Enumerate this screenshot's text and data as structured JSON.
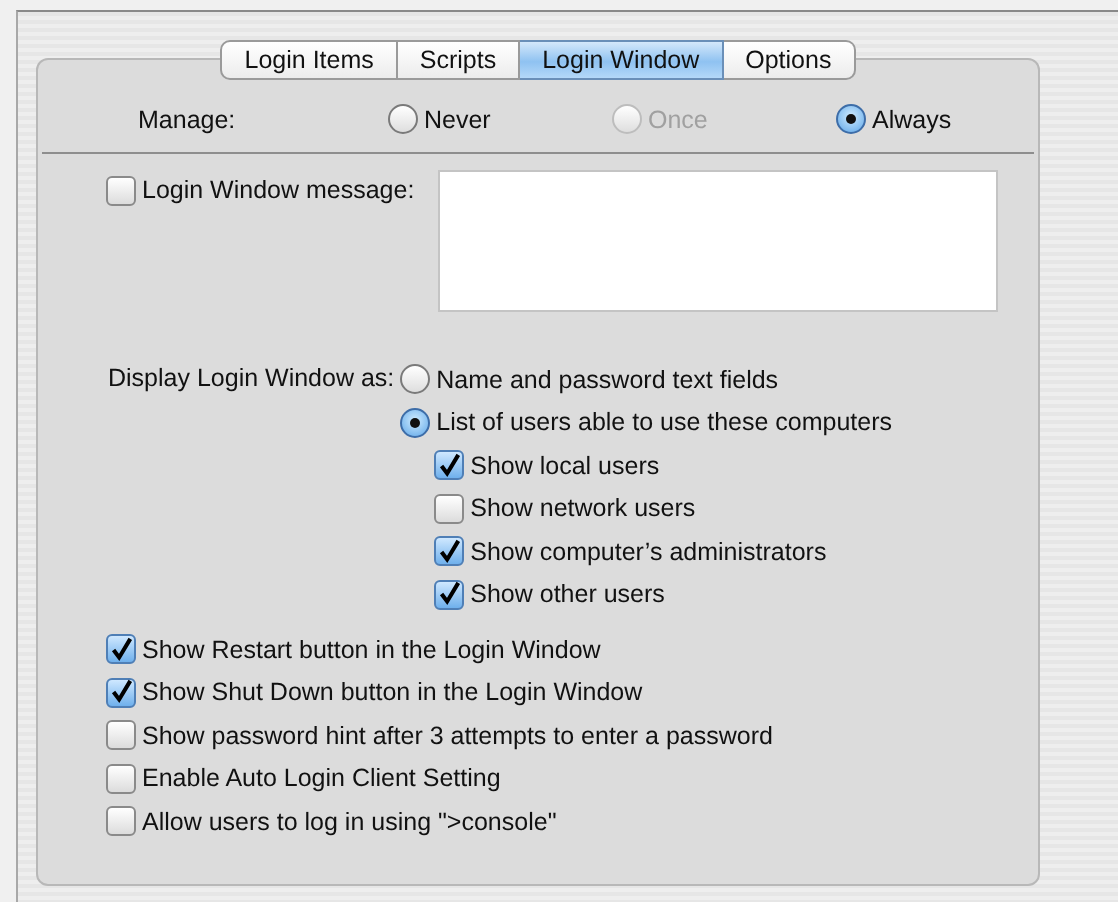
{
  "tabs": [
    {
      "label": "Login Items",
      "selected": false
    },
    {
      "label": "Scripts",
      "selected": false
    },
    {
      "label": "Login Window",
      "selected": true
    },
    {
      "label": "Options",
      "selected": false
    }
  ],
  "manage": {
    "label": "Manage:",
    "options": [
      {
        "label": "Never",
        "selected": false,
        "disabled": false
      },
      {
        "label": "Once",
        "selected": false,
        "disabled": true
      },
      {
        "label": "Always",
        "selected": true,
        "disabled": false
      }
    ]
  },
  "message": {
    "label": "Login Window message:",
    "checked": false
  },
  "display": {
    "label": "Display Login Window as:",
    "options": [
      {
        "label": "Name and password text fields",
        "selected": false
      },
      {
        "label": "List of users able to use these computers",
        "selected": true
      }
    ],
    "user_filters": [
      {
        "label": "Show local users",
        "checked": true
      },
      {
        "label": "Show network users",
        "checked": false
      },
      {
        "label": "Show computer’s administrators",
        "checked": true
      },
      {
        "label": "Show other users",
        "checked": true
      }
    ]
  },
  "options": [
    {
      "label": "Show Restart button in the Login Window",
      "checked": true
    },
    {
      "label": "Show Shut Down button in the Login Window",
      "checked": true
    },
    {
      "label": "Show password hint after 3 attempts to enter a password",
      "checked": false
    },
    {
      "label": "Enable Auto Login Client Setting",
      "checked": false
    },
    {
      "label": "Allow users to log in using \">console\"",
      "checked": false
    }
  ]
}
